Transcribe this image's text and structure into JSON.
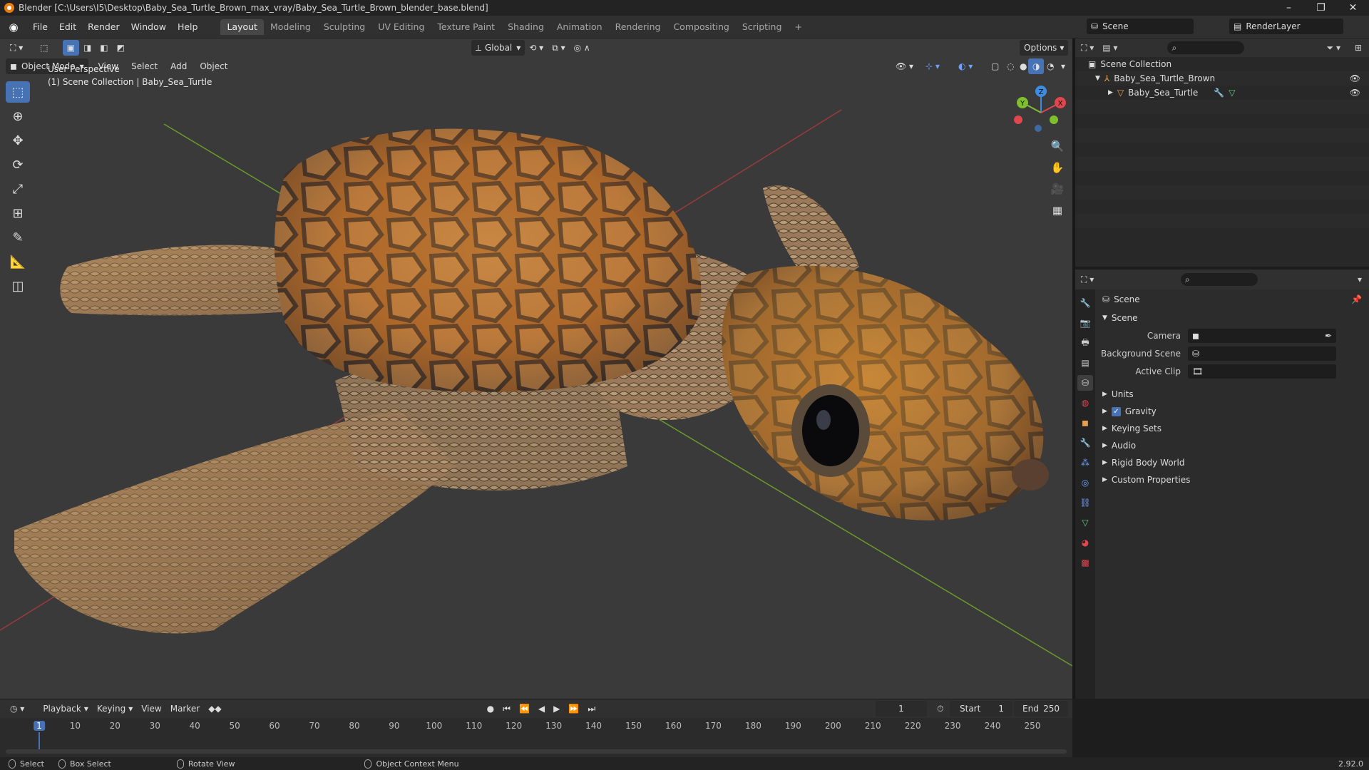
{
  "window": {
    "title": "Blender [C:\\Users\\I5\\Desktop\\Baby_Sea_Turtle_Brown_max_vray/Baby_Sea_Turtle_Brown_blender_base.blend]",
    "minimize": "–",
    "maximize": "❐",
    "close": "✕"
  },
  "menus": [
    "File",
    "Edit",
    "Render",
    "Window",
    "Help"
  ],
  "workspaces": [
    {
      "label": "Layout",
      "active": true
    },
    {
      "label": "Modeling",
      "active": false
    },
    {
      "label": "Sculpting",
      "active": false
    },
    {
      "label": "UV Editing",
      "active": false
    },
    {
      "label": "Texture Paint",
      "active": false
    },
    {
      "label": "Shading",
      "active": false
    },
    {
      "label": "Animation",
      "active": false
    },
    {
      "label": "Rendering",
      "active": false
    },
    {
      "label": "Compositing",
      "active": false
    },
    {
      "label": "Scripting",
      "active": false
    }
  ],
  "add_workspace": "+",
  "scene_selector": {
    "value": "Scene"
  },
  "view_layer_selector": {
    "value": "RenderLayer"
  },
  "viewport": {
    "mode": "Object Mode",
    "menus": [
      "View",
      "Select",
      "Add",
      "Object"
    ],
    "transform_orientation": "Global",
    "options_label": "Options",
    "perspective_label": "User Perspective",
    "collection_label": "(1) Scene Collection | Baby_Sea_Turtle",
    "gizmo_axes": {
      "x": "X",
      "y": "Y",
      "z": "Z"
    }
  },
  "outliner": {
    "root": "Scene Collection",
    "items": [
      {
        "label": "Baby_Sea_Turtle_Brown",
        "level": 1
      },
      {
        "label": "Baby_Sea_Turtle",
        "level": 2
      }
    ]
  },
  "properties": {
    "context_label": "Scene",
    "panel_title": "Scene",
    "fields": [
      {
        "label": "Camera",
        "value": ""
      },
      {
        "label": "Background Scene",
        "value": ""
      },
      {
        "label": "Active Clip",
        "value": ""
      }
    ],
    "subpanels": [
      {
        "label": "Units",
        "checkbox": false
      },
      {
        "label": "Gravity",
        "checkbox": true
      },
      {
        "label": "Keying Sets",
        "checkbox": false
      },
      {
        "label": "Audio",
        "checkbox": false
      },
      {
        "label": "Rigid Body World",
        "checkbox": false
      },
      {
        "label": "Custom Properties",
        "checkbox": false
      }
    ]
  },
  "timeline": {
    "menus": [
      "Playback",
      "Keying",
      "View",
      "Marker"
    ],
    "current_frame": "1",
    "start_label": "Start",
    "start_value": "1",
    "end_label": "End",
    "end_value": "250",
    "ticks": [
      "1",
      "10",
      "20",
      "30",
      "40",
      "50",
      "60",
      "70",
      "80",
      "90",
      "100",
      "110",
      "120",
      "130",
      "140",
      "150",
      "160",
      "170",
      "180",
      "190",
      "200",
      "210",
      "220",
      "230",
      "240",
      "250"
    ]
  },
  "statusbar": {
    "select": "Select",
    "box_select": "Box Select",
    "rotate_view": "Rotate View",
    "context_menu": "Object Context Menu",
    "version": "2.92.0"
  },
  "colors": {
    "accent": "#4772b3",
    "x_axis": "#e0464e",
    "y_axis": "#7fbf2e",
    "z_axis": "#3f8be0",
    "frame_indicator": "#4772b3"
  }
}
